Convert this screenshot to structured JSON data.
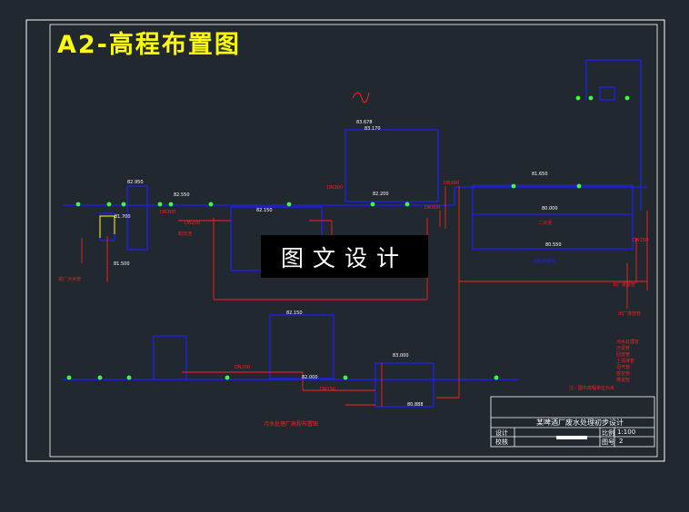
{
  "drawing_title": "A2-高程布置图",
  "watermark": "图文设计",
  "caption": "污水处理厂高程布置图",
  "title_block": {
    "project": "某啤酒厂废水处理初步设计",
    "row_labels": [
      "设计",
      "校核"
    ],
    "scale_label": "比例",
    "scale_value": "1:100",
    "sheet_label": "图号",
    "sheet_value": "2"
  },
  "units": {
    "primary_clarifier": "初沉池",
    "secondary_clarifier": "二沉池",
    "sludge_tank": "污泥浓缩池",
    "inlet_note": "进厂污水管",
    "outlet_note": "出厂排放管",
    "outfall_note": "出厂排放管"
  },
  "legend": {
    "items": [
      "污水处理管",
      "污泥管",
      "回流管",
      "上清液管",
      "沼气管",
      "放空管",
      "排泥管"
    ],
    "note": "注：图中高程单位为米"
  },
  "pipe_labels": [
    "DN300",
    "DN300",
    "DN300",
    "DN300",
    "DN200",
    "DN150",
    "DN150",
    "DN200"
  ],
  "elevations": [
    "82.950",
    "82.550",
    "82.150",
    "81.700",
    "81.500",
    "83.678",
    "83.170",
    "82.200",
    "81.650",
    "80.550",
    "80.000",
    "82.150",
    "82.000",
    "83.000",
    "80.888"
  ],
  "colors": {
    "background": "#212830",
    "frame": "#ffffff",
    "water_pipe": "#1e1eff",
    "sludge_pipe": "#ff2020",
    "title": "#ffff00",
    "level_marker": "#40ff40"
  }
}
